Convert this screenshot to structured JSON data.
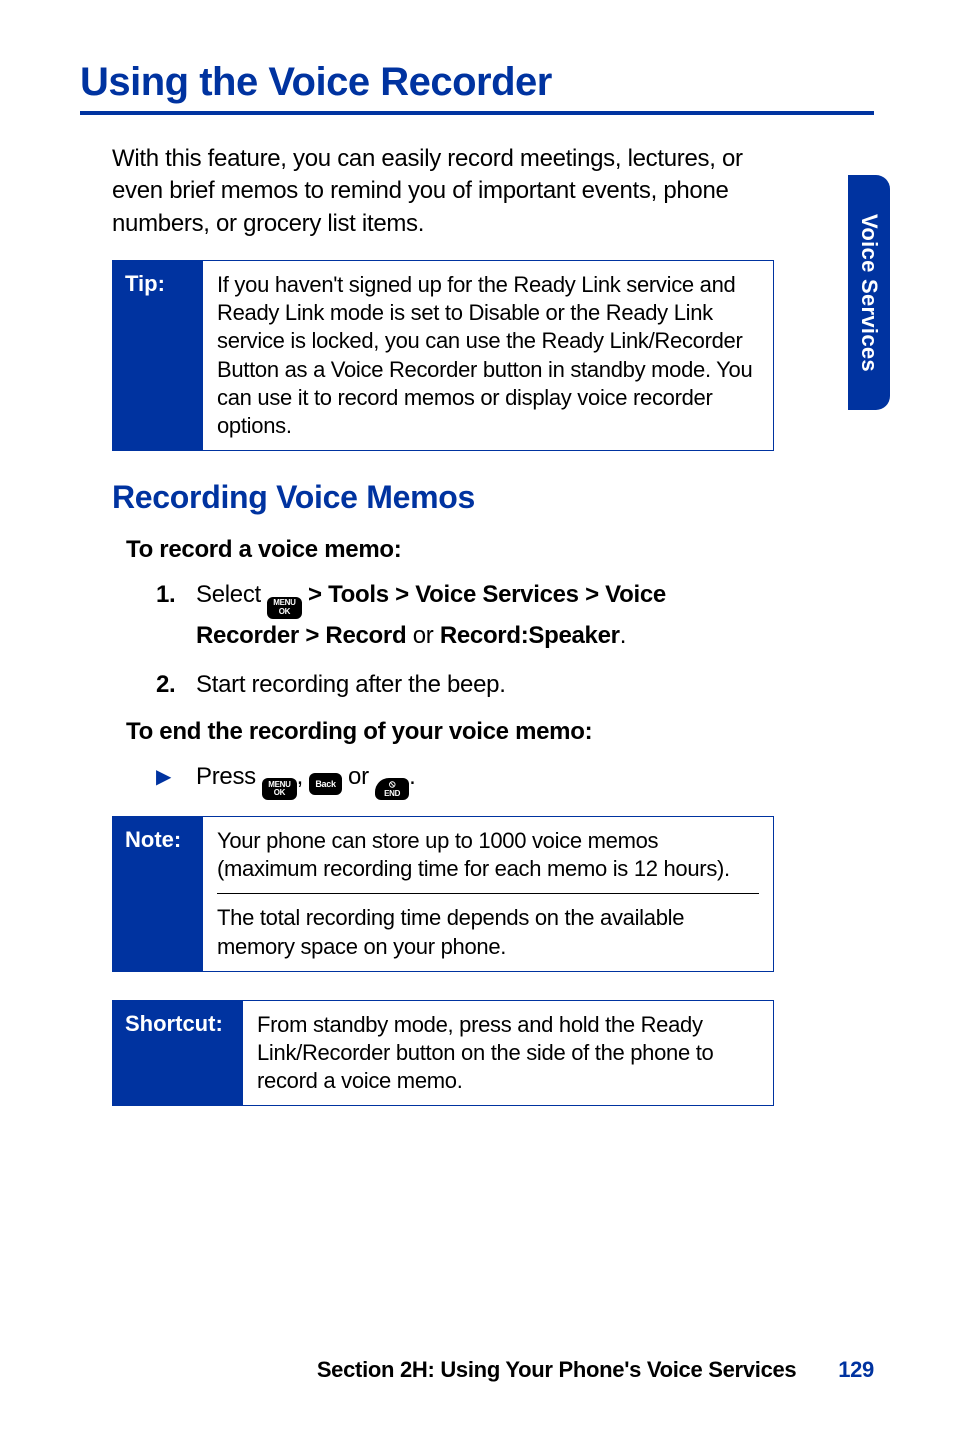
{
  "side_tab": "Voice Services",
  "title": "Using the Voice Recorder",
  "intro": "With this feature, you can easily record meetings, lectures, or even brief memos to remind you of important events, phone numbers, or grocery list items.",
  "tip": {
    "label": "Tip:",
    "text": "If you haven't signed up for the Ready Link service and Ready Link mode is set to Disable or the Ready Link service is locked, you can use the Ready Link/Recorder Button as a Voice Recorder button in standby mode. You can use it to record memos or display voice recorder options."
  },
  "subheading": "Recording Voice Memos",
  "instr1_head": "To record a voice memo:",
  "step1": {
    "num": "1.",
    "lead": "Select ",
    "path": " > Tools > Voice Services > Voice Recorder > Record",
    "or": " or ",
    "alt": "Record:Speaker",
    "tail": "."
  },
  "step2": {
    "num": "2.",
    "text": "Start recording after the beep."
  },
  "instr2_head": "To end the recording of your voice memo:",
  "press_line": {
    "lead": "Press ",
    "sep1": ", ",
    "sep2": " or ",
    "tail": "."
  },
  "keys": {
    "menu_top": "MENU",
    "menu_bottom": "OK",
    "back": "Back",
    "end_top": "⦸",
    "end_bottom": "END"
  },
  "note": {
    "label": "Note:",
    "text1": "Your phone can store up to 1000 voice memos (maximum recording time for each memo is 12 hours).",
    "text2": "The total recording time depends on the available memory space on your phone."
  },
  "shortcut": {
    "label": "Shortcut:",
    "text": "From standby mode, press and hold the Ready Link/Recorder button on the side of the phone to record a voice memo."
  },
  "footer": {
    "text": "Section 2H: Using Your Phone's Voice Services",
    "page": "129"
  }
}
